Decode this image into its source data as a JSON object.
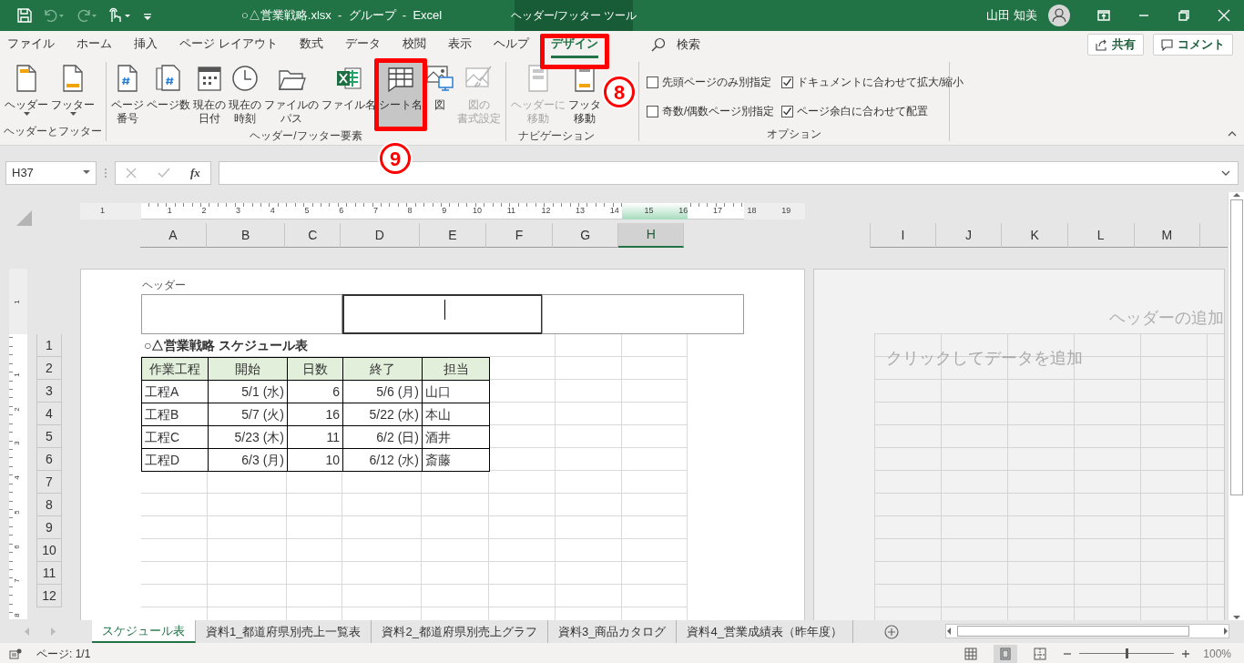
{
  "window": {
    "title": "○△営業戦略.xlsx  -  グループ  -  Excel",
    "context_tab": "ヘッダー/フッター ツール",
    "user": "山田 知美"
  },
  "ribbon_tabs": [
    {
      "label": "ファイル",
      "selected": false
    },
    {
      "label": "ホーム",
      "selected": false
    },
    {
      "label": "挿入",
      "selected": false
    },
    {
      "label": "ページ レイアウト",
      "selected": false
    },
    {
      "label": "数式",
      "selected": false
    },
    {
      "label": "データ",
      "selected": false
    },
    {
      "label": "校閲",
      "selected": false
    },
    {
      "label": "表示",
      "selected": false
    },
    {
      "label": "ヘルプ",
      "selected": false
    },
    {
      "label": "デザイン",
      "selected": true
    }
  ],
  "search": {
    "label": "検索"
  },
  "share_button": {
    "label": "共有"
  },
  "comment_button": {
    "label": "コメント"
  },
  "ribbon_groups": [
    {
      "label": "ヘッダーとフッター",
      "buttons": [
        {
          "lines": [
            "ヘッダー"
          ],
          "dropdown": true,
          "disabled": false,
          "pressed": false
        },
        {
          "lines": [
            "フッター"
          ],
          "dropdown": true,
          "disabled": false,
          "pressed": false
        }
      ]
    },
    {
      "label": "ヘッダー/フッター要素",
      "buttons": [
        {
          "lines": [
            "ページ",
            "番号"
          ],
          "dropdown": false,
          "disabled": false,
          "pressed": false
        },
        {
          "lines": [
            "ページ数"
          ],
          "dropdown": false,
          "disabled": false,
          "pressed": false
        },
        {
          "lines": [
            "現在の",
            "日付"
          ],
          "dropdown": false,
          "disabled": false,
          "pressed": false
        },
        {
          "lines": [
            "現在の",
            "時刻"
          ],
          "dropdown": false,
          "disabled": false,
          "pressed": false
        },
        {
          "lines": [
            "ファイルの",
            "パス"
          ],
          "dropdown": false,
          "disabled": false,
          "pressed": false
        },
        {
          "lines": [
            "ファイル名"
          ],
          "dropdown": false,
          "disabled": false,
          "pressed": false
        },
        {
          "lines": [
            "シート名"
          ],
          "dropdown": false,
          "disabled": false,
          "pressed": true
        },
        {
          "lines": [
            "図"
          ],
          "dropdown": false,
          "disabled": false,
          "pressed": false
        },
        {
          "lines": [
            "図の",
            "書式設定"
          ],
          "dropdown": false,
          "disabled": true,
          "pressed": false
        }
      ]
    },
    {
      "label": "ナビゲーション",
      "buttons": [
        {
          "lines": [
            "ヘッダーに",
            "移動"
          ],
          "dropdown": false,
          "disabled": true,
          "pressed": false
        },
        {
          "lines": [
            "フッタ",
            "移動"
          ],
          "dropdown": false,
          "disabled": false,
          "pressed": false
        }
      ]
    },
    {
      "label": "オプション",
      "checkboxes": [
        {
          "label": "先頭ページのみ別指定",
          "checked": false
        },
        {
          "label": "奇数/偶数ページ別指定",
          "checked": false
        },
        {
          "label": "ドキュメントに合わせて拡大/縮小",
          "checked": true
        },
        {
          "label": "ページ余白に合わせて配置",
          "checked": true
        }
      ]
    }
  ],
  "annotations": [
    {
      "number": "8"
    },
    {
      "number": "9"
    }
  ],
  "formula_bar": {
    "name_box": "H37",
    "function_label": "fx"
  },
  "ruler": {
    "labels": [
      "1",
      "1",
      "2",
      "3",
      "4",
      "5",
      "6",
      "7",
      "8",
      "9",
      "10",
      "11",
      "12",
      "13",
      "14",
      "15",
      "16",
      "17",
      "18",
      "19"
    ]
  },
  "vertical_ruler": {
    "labels": [
      "1",
      "1",
      "2",
      "3",
      "4",
      "5",
      "6",
      "7",
      "8"
    ]
  },
  "columns": {
    "left": [
      {
        "label": "A",
        "selected": false
      },
      {
        "label": "B",
        "selected": false
      },
      {
        "label": "C",
        "selected": false
      },
      {
        "label": "D",
        "selected": false
      },
      {
        "label": "E",
        "selected": false
      },
      {
        "label": "F",
        "selected": false
      },
      {
        "label": "G",
        "selected": false
      },
      {
        "label": "H",
        "selected": true
      }
    ],
    "right": [
      {
        "label": "I",
        "selected": false
      },
      {
        "label": "J",
        "selected": false
      },
      {
        "label": "K",
        "selected": false
      },
      {
        "label": "L",
        "selected": false
      },
      {
        "label": "M",
        "selected": false
      }
    ]
  },
  "row_headers": [
    "1",
    "2",
    "3",
    "4",
    "5",
    "6",
    "7",
    "8",
    "9",
    "10",
    "11",
    "12"
  ],
  "page": {
    "header_label": "ヘッダー",
    "header_sections": [
      {
        "selected": false
      },
      {
        "selected": true
      },
      {
        "selected": false
      }
    ],
    "title": "○△営業戦略 スケジュール表",
    "table": {
      "columns": [
        "作業工程",
        "開始",
        "日数",
        "終了",
        "担当"
      ],
      "rows": [
        [
          "工程A",
          "5/1 (水)",
          "6",
          "5/6 (月)",
          "山口"
        ],
        [
          "工程B",
          "5/7 (火)",
          "16",
          "5/22 (水)",
          "本山"
        ],
        [
          "工程C",
          "5/23 (木)",
          "11",
          "6/2 (日)",
          "酒井"
        ],
        [
          "工程D",
          "6/3 (月)",
          "10",
          "6/12 (水)",
          "斎藤"
        ]
      ]
    }
  },
  "right_page": {
    "header_hint": "ヘッダーの追加",
    "body_hint": "クリックしてデータを追加"
  },
  "sheet_tabs": [
    {
      "label": "スケジュール表",
      "selected": true
    },
    {
      "label": "資料1_都道府県別売上一覧表",
      "selected": false
    },
    {
      "label": "資料2_都道府県別売上グラフ",
      "selected": false
    },
    {
      "label": "資料3_商品カタログ",
      "selected": false
    },
    {
      "label": "資料4_営業成績表（昨年度）",
      "selected": false
    }
  ],
  "status_bar": {
    "page": "ページ: 1/1",
    "views": [
      {
        "selected": false
      },
      {
        "selected": true
      },
      {
        "selected": false
      }
    ],
    "zoom": {
      "level": 0.5
    },
    "zoom_label": "100%"
  }
}
